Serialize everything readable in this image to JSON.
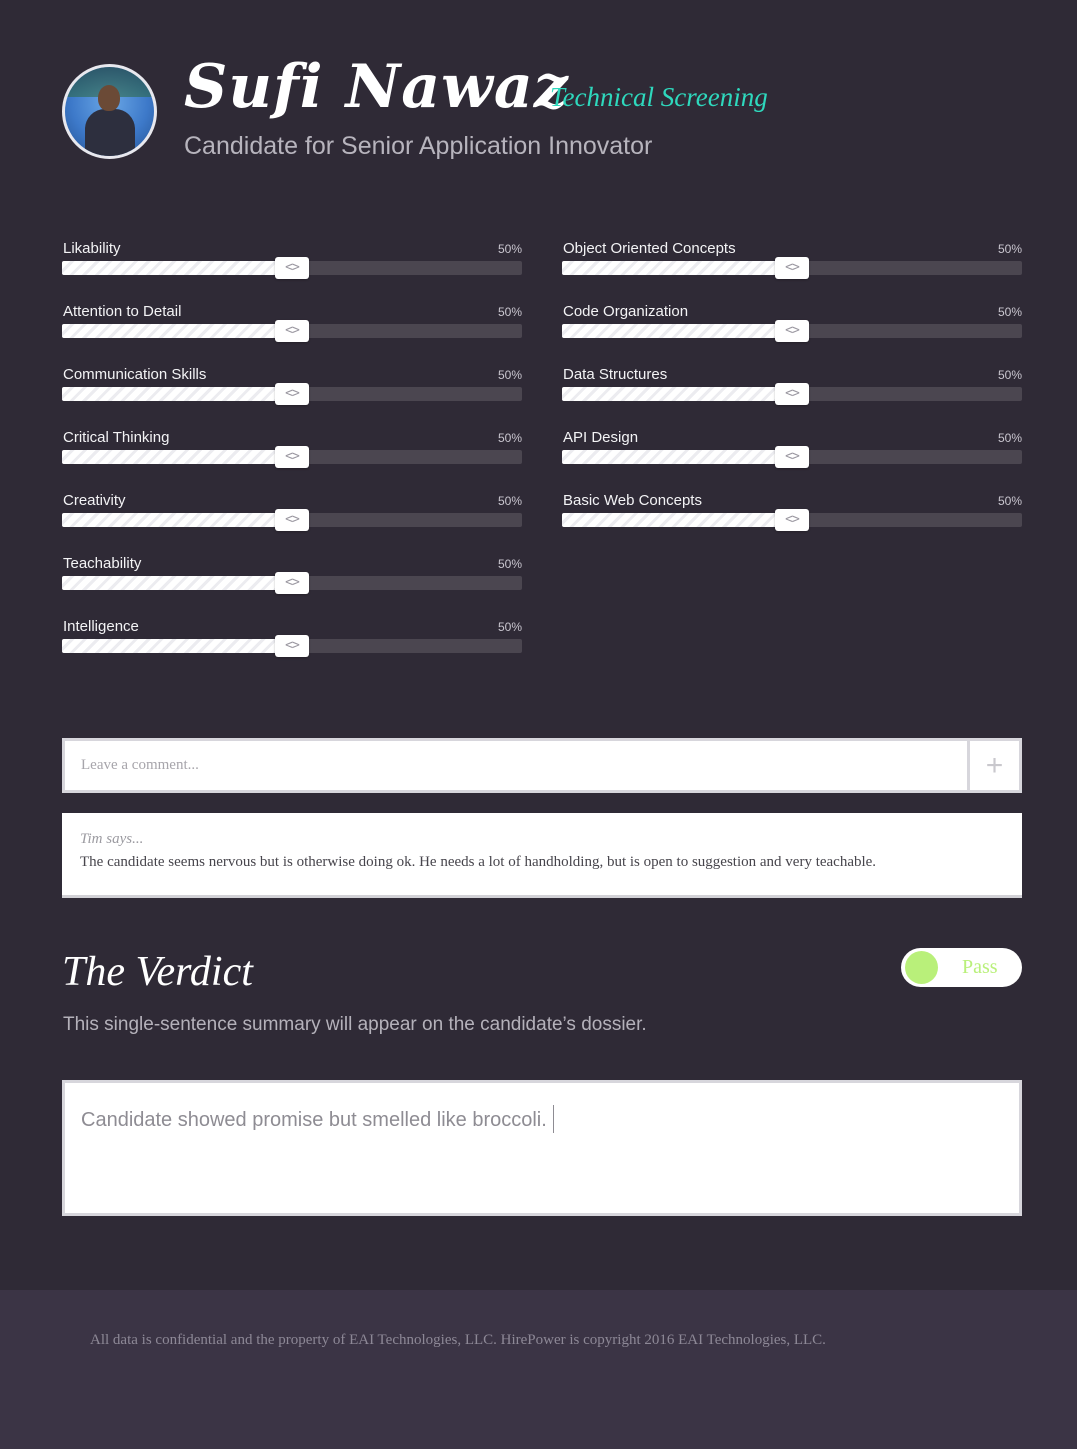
{
  "candidate": {
    "name": "Sufi Nawaz",
    "stage": "Technical Screening",
    "subtitle": "Candidate for Senior Application Innovator"
  },
  "skills_left": [
    {
      "label": "Likability",
      "value": 50,
      "pct_label": "50%"
    },
    {
      "label": "Attention to Detail",
      "value": 50,
      "pct_label": "50%"
    },
    {
      "label": "Communication Skills",
      "value": 50,
      "pct_label": "50%"
    },
    {
      "label": "Critical Thinking",
      "value": 50,
      "pct_label": "50%"
    },
    {
      "label": "Creativity",
      "value": 50,
      "pct_label": "50%"
    },
    {
      "label": "Teachability",
      "value": 50,
      "pct_label": "50%"
    },
    {
      "label": "Intelligence",
      "value": 50,
      "pct_label": "50%"
    }
  ],
  "skills_right": [
    {
      "label": "Object Oriented Concepts",
      "value": 50,
      "pct_label": "50%"
    },
    {
      "label": "Code Organization",
      "value": 50,
      "pct_label": "50%"
    },
    {
      "label": "Data Structures",
      "value": 50,
      "pct_label": "50%"
    },
    {
      "label": "API Design",
      "value": 50,
      "pct_label": "50%"
    },
    {
      "label": "Basic Web Concepts",
      "value": 50,
      "pct_label": "50%"
    }
  ],
  "slider_handle_glyph": "<>",
  "comment": {
    "placeholder": "Leave a comment...",
    "add_label": "+"
  },
  "comments": [
    {
      "author": "Tim says...",
      "text": "The candidate seems nervous but is otherwise doing ok. He needs a lot of handholding, but is open to suggestion and very teachable."
    }
  ],
  "verdict": {
    "title": "The Verdict",
    "description": "This single-sentence summary will appear on the candidate’s dossier.",
    "toggle_label": "Pass",
    "toggle_on": true,
    "summary": "Candidate showed promise but smelled like broccoli."
  },
  "footer": {
    "text": "All data is confidential and the property of EAI Technologies, LLC.  HirePower is copyright 2016 EAI Technologies, LLC."
  },
  "colors": {
    "background": "#2f2a36",
    "accent_teal": "#2ed8bd",
    "pass_green": "#b9f07a",
    "footer": "#3b3445"
  }
}
